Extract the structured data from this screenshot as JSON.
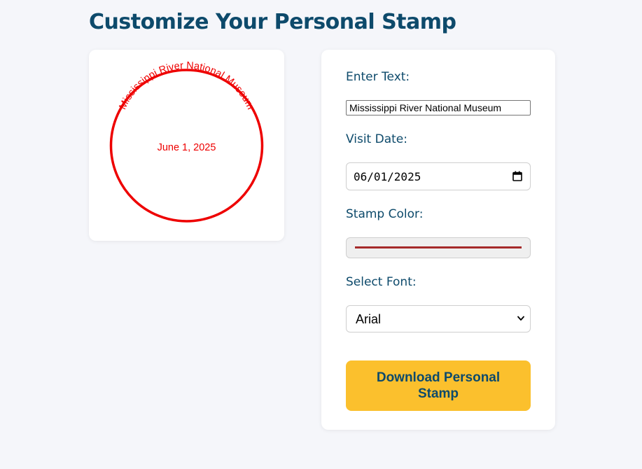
{
  "page": {
    "title": "Customize Your Personal Stamp"
  },
  "stamp": {
    "text": "Mississippi River National Museum",
    "date_text": "June 1, 2025",
    "color": "#ee0000"
  },
  "form": {
    "text_label": "Enter Text:",
    "text_value": "Mississippi River National Museum",
    "date_label": "Visit Date:",
    "date_value": "06/01/2025",
    "color_label": "Stamp Color:",
    "color_value": "#a52a2a",
    "font_label": "Select Font:",
    "font_value": "Arial",
    "download_label": "Download Personal Stamp"
  },
  "colors": {
    "heading": "#0d4a6b",
    "button": "#fbc02d",
    "background": "#f5f6fa"
  },
  "icons": {
    "date": "calendar-icon",
    "select": "chevron-down-icon"
  }
}
